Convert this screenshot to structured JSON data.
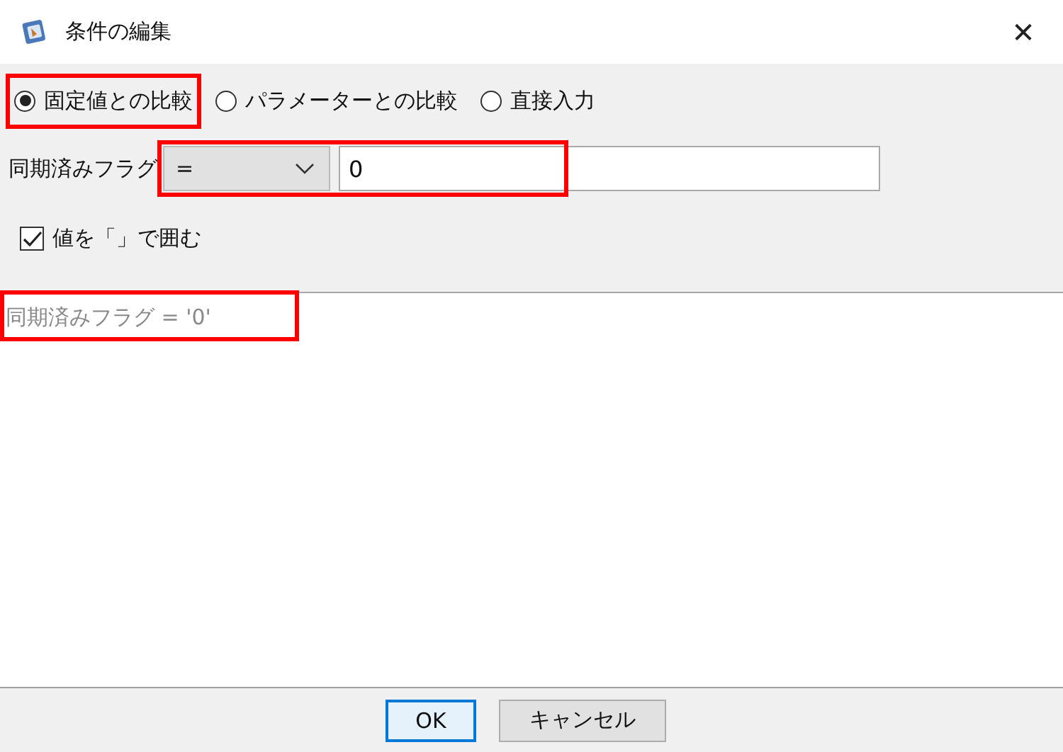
{
  "window": {
    "title": "条件の編集",
    "close": "✕"
  },
  "modes": [
    {
      "label": "固定値との比較",
      "selected": true,
      "highlighted": true
    },
    {
      "label": "パラメーターとの比較",
      "selected": false,
      "highlighted": false
    },
    {
      "label": "直接入力",
      "selected": false,
      "highlighted": false
    }
  ],
  "condition": {
    "field_label": "同期済みフラグ",
    "operator": "=",
    "value": "0",
    "highlighted": true
  },
  "quote_option": {
    "label": "値を「」で囲む",
    "checked": true
  },
  "preview": {
    "text": "同期済みフラグ = '0'",
    "highlighted": true
  },
  "buttons": [
    {
      "label": "OK",
      "default": true
    },
    {
      "label": "キャンセル",
      "default": false
    }
  ]
}
